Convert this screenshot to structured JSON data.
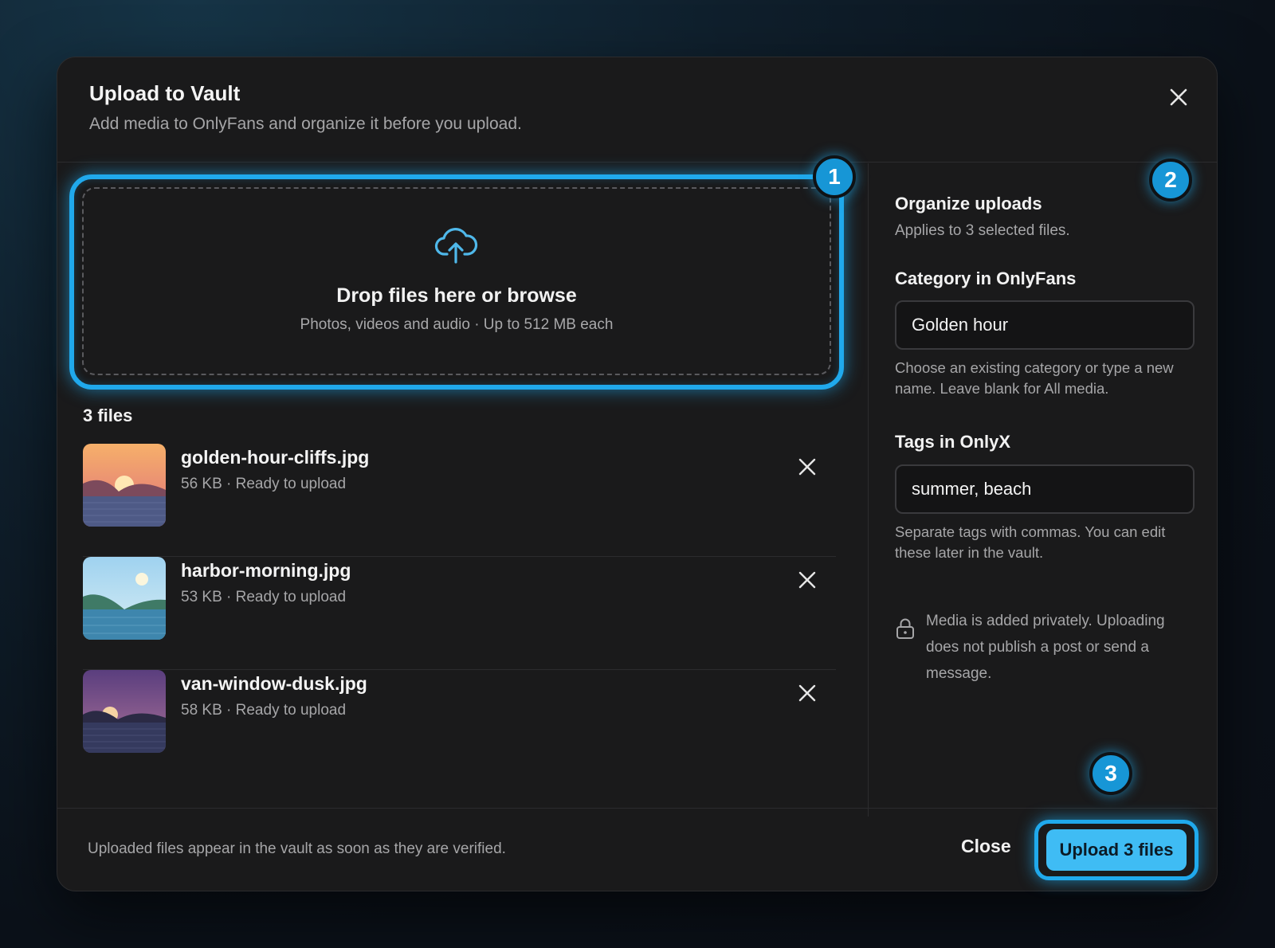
{
  "dialog": {
    "title": "Upload to Vault",
    "subtitle": "Add media to OnlyFans and organize it before you upload."
  },
  "dropzone": {
    "title": "Drop files here or browse",
    "subtitle": "Photos, videos and audio · Up to 512 MB each",
    "icon": "cloud-upload-icon"
  },
  "badges": [
    "1",
    "2",
    "3"
  ],
  "files": {
    "count_label": "3 files",
    "items": [
      {
        "name": "golden-hour-cliffs.jpg",
        "meta": "56 KB · Ready to upload"
      },
      {
        "name": "harbor-morning.jpg",
        "meta": "53 KB · Ready to upload"
      },
      {
        "name": "van-window-dusk.jpg",
        "meta": "58 KB · Ready to upload"
      }
    ]
  },
  "organize": {
    "title": "Organize uploads",
    "subtitle": "Applies to 3 selected files.",
    "category": {
      "label": "Category in OnlyFans",
      "value": "Golden hour",
      "help": "Choose an existing category or type a new name. Leave blank for All media."
    },
    "tags": {
      "label": "Tags in OnlyX",
      "value": "summer, beach",
      "help": "Separate tags with commas. You can edit these later in the vault."
    },
    "privacy_note": "Media is added privately. Uploading does not publish a post or send a message."
  },
  "footer": {
    "note": "Uploaded files appear in the vault as soon as they are verified.",
    "close_label": "Close",
    "upload_label": "Upload 3 files"
  },
  "colors": {
    "accent": "#20a9ec",
    "button": "#3fbcf4",
    "panel": "#1a1a1b"
  }
}
